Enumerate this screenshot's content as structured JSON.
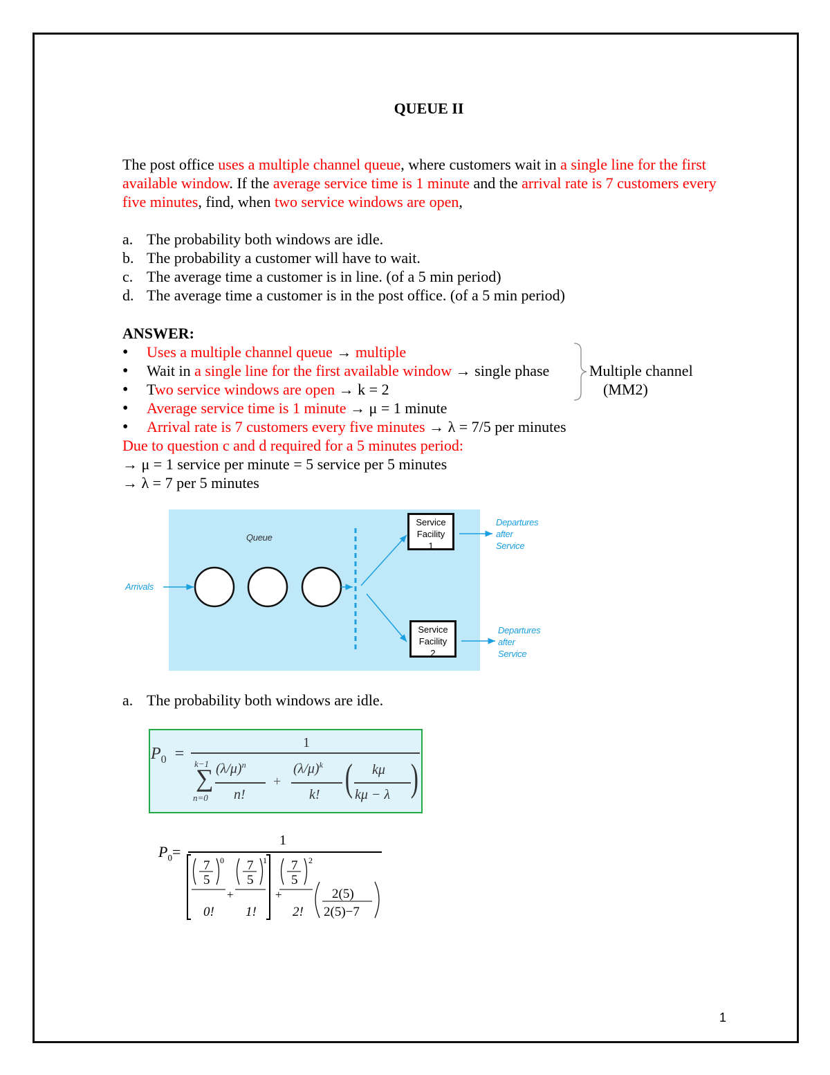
{
  "document": {
    "title": "QUEUE II",
    "page_number": "1",
    "intro": [
      {
        "text": "The post office ",
        "red": false
      },
      {
        "text": "uses a multiple channel queue",
        "red": true
      },
      {
        "text": ", where customers wait in ",
        "red": false
      },
      {
        "text": "a single line for the first available window",
        "red": true
      },
      {
        "text": ". If the ",
        "red": false
      },
      {
        "text": "average service time is 1 minute",
        "red": true
      },
      {
        "text": " and the ",
        "red": false
      },
      {
        "text": "arrival rate is 7 customers every five minutes",
        "red": true
      },
      {
        "text": ", find, when ",
        "red": false
      },
      {
        "text": "two service windows are open",
        "red": true
      },
      {
        "text": ",",
        "red": false
      }
    ],
    "questions": [
      {
        "label": "a.",
        "text": "The probability both windows are idle."
      },
      {
        "label": "b.",
        "text": "The probability a customer will have to wait."
      },
      {
        "label": "c.",
        "text": "The average time a customer is in line. (of a 5 min period)"
      },
      {
        "label": "d.",
        "text": "The average time a customer is in the post office. (of a 5 min period)"
      }
    ],
    "answer_heading": "ANSWER:",
    "bullets": [
      [
        {
          "text": "Uses a multiple channel queue",
          "red": true
        },
        {
          "text": " → ",
          "red": false
        },
        {
          "text": "multiple",
          "red": true
        }
      ],
      [
        {
          "text": "Wait in ",
          "red": false
        },
        {
          "text": "a single line for the first available window",
          "red": true
        },
        {
          "text": " → single phase",
          "red": false
        }
      ],
      [
        {
          "text": "T",
          "red": false
        },
        {
          "text": "wo service windows are open",
          "red": true
        },
        {
          "text": " → k = 2",
          "red": false
        }
      ],
      [
        {
          "text": "Average service time is 1 minute",
          "red": true
        },
        {
          "text": "  → μ = 1 minute",
          "red": false
        }
      ],
      [
        {
          "text": "Arrival rate is 7 customers every five minutes",
          "red": true
        },
        {
          "text": " → λ = 7/5 per minutes",
          "red": false
        }
      ]
    ],
    "brace_label_line1": "Multiple channel",
    "brace_label_line2": "(MM2)",
    "period_note": "Due to question c and d required for a 5 minutes period:",
    "mu_line": "→ μ = 1 service per minute = 5 service per 5 minutes",
    "lambda_line": "→  λ = 7 per 5 minutes",
    "diagram": {
      "queue_label": "Queue",
      "arrivals_label": "Arrivals",
      "facility_1": [
        "Service",
        "Facility",
        "1"
      ],
      "facility_2": [
        "Service",
        "Facility",
        "2"
      ],
      "departures_1": [
        "Departures",
        "after",
        "Service"
      ],
      "departures_2": [
        "Departures",
        "after",
        "Service"
      ]
    },
    "part_a_label": "a.",
    "part_a_text": "The probability both windows are idle.",
    "formula_general": {
      "lhs": "P",
      "lhs_sub": "0",
      "numerator": "1",
      "sum_top": "k−1",
      "sum_bottom": "n=0",
      "term1_num": "(λ/μ)",
      "term1_exp": "n",
      "term1_den": "n!",
      "plus": "+",
      "term2_num": "(λ/μ)",
      "term2_exp": "k",
      "term2_den": "k!",
      "frac_num": "kμ",
      "frac_den": "kμ − λ"
    },
    "formula_substituted": {
      "lhs": "P",
      "lhs_sub": "0",
      "equals": "=",
      "numerator": "1",
      "t1_num": "7",
      "t1_den": "5",
      "t1_exp": "0",
      "t1_fact": "0!",
      "t2_num": "7",
      "t2_den": "5",
      "t2_exp": "1",
      "t2_fact": "1!",
      "t3_num": "7",
      "t3_den": "5",
      "t3_exp": "2",
      "t3_fact": "2!",
      "frac_num": "2(5)",
      "frac_den": "2(5)−7",
      "plus": "+"
    }
  }
}
